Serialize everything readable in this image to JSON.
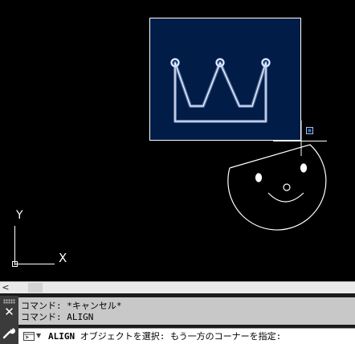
{
  "viewport": {
    "ucs": {
      "y_label": "Y",
      "x_label": "X"
    },
    "colors": {
      "background": "#000000",
      "selection_fill": "#011c47",
      "geometry": "#ffffff",
      "highlight": "#a7c2f5",
      "grip": "#2a6fd6"
    }
  },
  "scrollbar": {
    "left_arrow": "<"
  },
  "command": {
    "history": [
      "コマンド: *キャンセル*",
      "コマンド: ALIGN"
    ],
    "prompt": {
      "command_name": "ALIGN",
      "text": " オブジェクトを選択: もう一方のコーナーを指定:"
    },
    "close_symbol": "✕",
    "icons": {
      "close": "close-icon",
      "customize": "wrench-icon",
      "prompt": "command-prompt-icon",
      "dropdown": "chevron-down-icon"
    }
  }
}
